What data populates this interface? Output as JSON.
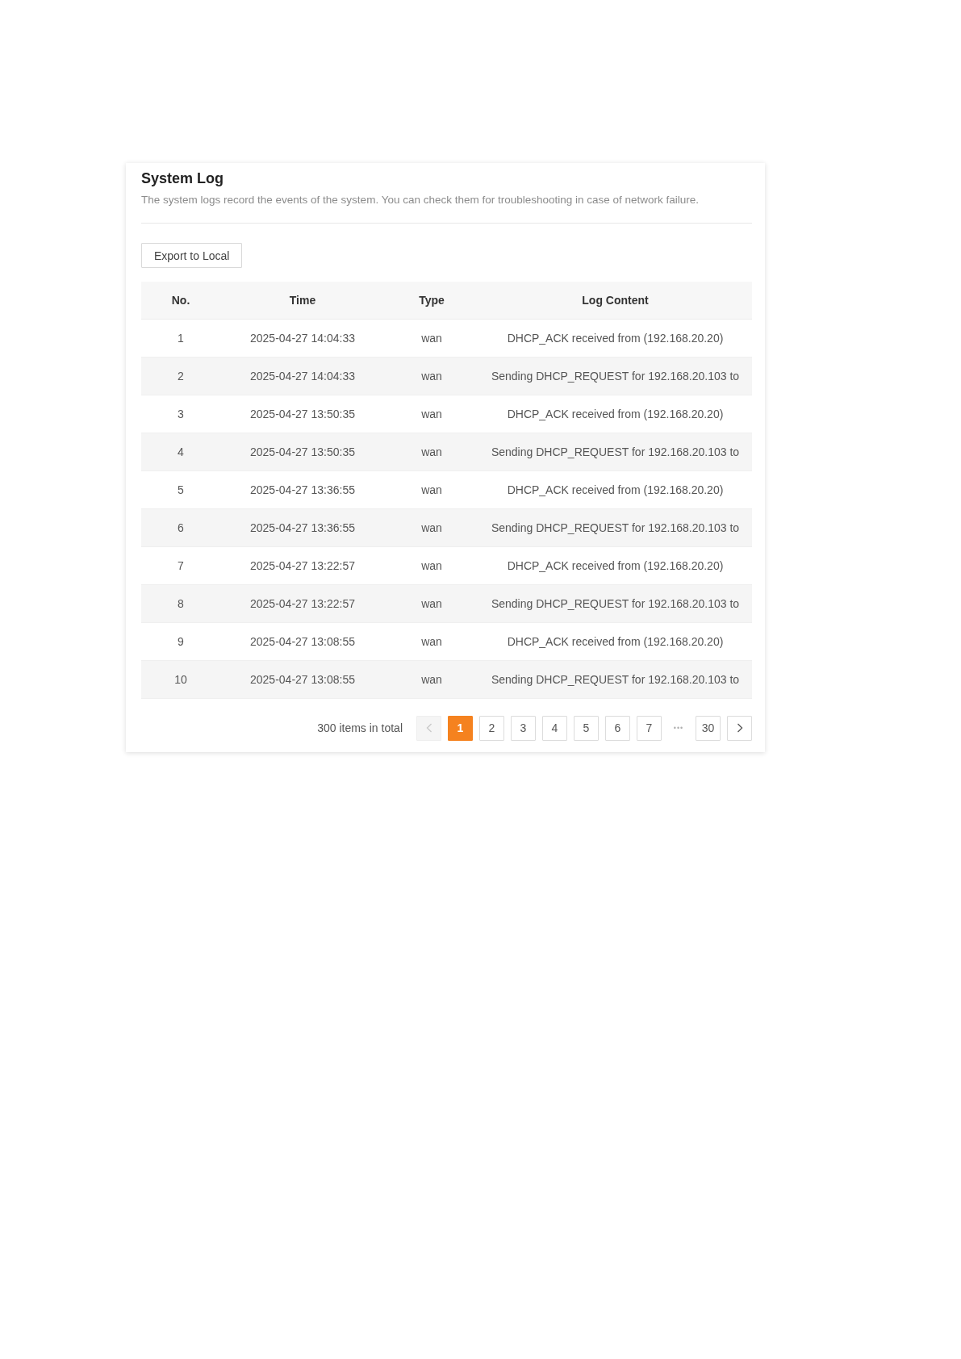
{
  "card": {
    "title": "System Log",
    "description": "The system logs record the events of the system. You can check them for troubleshooting in case of network failure."
  },
  "export_button": {
    "label": "Export to Local"
  },
  "table": {
    "columns": [
      "No.",
      "Time",
      "Type",
      "Log Content"
    ],
    "rows": [
      {
        "cells": [
          "1",
          "2025-04-27 14:04:33",
          "wan",
          "DHCP_ACK received from (192.168.20.20)"
        ]
      },
      {
        "cells": [
          "2",
          "2025-04-27 14:04:33",
          "wan",
          "Sending DHCP_REQUEST for 192.168.20.103 to"
        ]
      },
      {
        "cells": [
          "3",
          "2025-04-27 13:50:35",
          "wan",
          "DHCP_ACK received from (192.168.20.20)"
        ]
      },
      {
        "cells": [
          "4",
          "2025-04-27 13:50:35",
          "wan",
          "Sending DHCP_REQUEST for 192.168.20.103 to"
        ]
      },
      {
        "cells": [
          "5",
          "2025-04-27 13:36:55",
          "wan",
          "DHCP_ACK received from (192.168.20.20)"
        ]
      },
      {
        "cells": [
          "6",
          "2025-04-27 13:36:55",
          "wan",
          "Sending DHCP_REQUEST for 192.168.20.103 to"
        ]
      },
      {
        "cells": [
          "7",
          "2025-04-27 13:22:57",
          "wan",
          "DHCP_ACK received from (192.168.20.20)"
        ]
      },
      {
        "cells": [
          "8",
          "2025-04-27 13:22:57",
          "wan",
          "Sending DHCP_REQUEST for 192.168.20.103 to"
        ]
      },
      {
        "cells": [
          "9",
          "2025-04-27 13:08:55",
          "wan",
          "DHCP_ACK received from (192.168.20.20)"
        ]
      },
      {
        "cells": [
          "10",
          "2025-04-27 13:08:55",
          "wan",
          "Sending DHCP_REQUEST for 192.168.20.103 to"
        ]
      }
    ]
  },
  "pagination": {
    "total": "300 items in total",
    "prev": {
      "disabled": true
    },
    "next": {
      "disabled": false
    },
    "pages": [
      {
        "kind": "page",
        "label": "1",
        "selected": true
      },
      {
        "kind": "page",
        "label": "2",
        "selected": false
      },
      {
        "kind": "page",
        "label": "3",
        "selected": false
      },
      {
        "kind": "page",
        "label": "4",
        "selected": false
      },
      {
        "kind": "page",
        "label": "5",
        "selected": false
      },
      {
        "kind": "page",
        "label": "6",
        "selected": false
      },
      {
        "kind": "page",
        "label": "7",
        "selected": false
      },
      {
        "kind": "ellipsis",
        "label": "•••"
      },
      {
        "kind": "page",
        "label": "30",
        "selected": false
      }
    ]
  }
}
